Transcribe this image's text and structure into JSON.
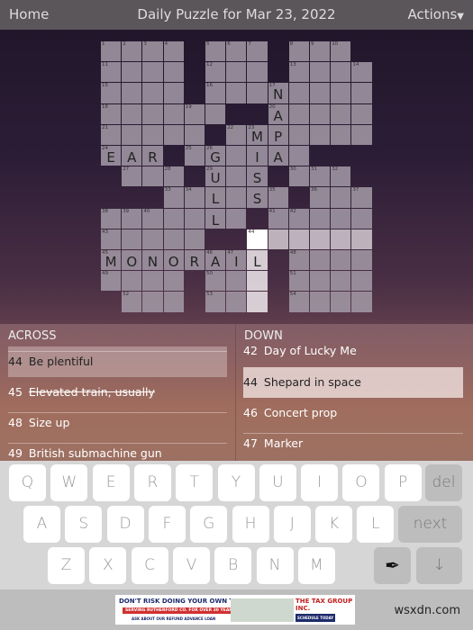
{
  "header": {
    "home": "Home",
    "title": "Daily Puzzle for Mar 23, 2022",
    "actions": "Actions",
    "actions_icon": "triangle-down-icon"
  },
  "grid": {
    "rows": [
      "....#...#...#",
      "....#...#....",
      "....#...N....",
      "......##A....",
      ".....#.MP....",
      "EAR#.G.IA.###",
      "#...#U.S#...#",
      "###..L.S.#...",
      ".....L.#.....",
      ".....##......",
      "MONORAIL#....",
      "....#...#....",
      "#...#...#...."
    ],
    "numbers": [
      [
        0,
        0,
        1
      ],
      [
        0,
        1,
        2
      ],
      [
        0,
        2,
        3
      ],
      [
        0,
        3,
        4
      ],
      [
        0,
        5,
        5
      ],
      [
        0,
        6,
        6
      ],
      [
        0,
        7,
        7
      ],
      [
        0,
        9,
        8
      ],
      [
        0,
        10,
        9
      ],
      [
        0,
        11,
        10
      ],
      [
        1,
        0,
        11
      ],
      [
        1,
        5,
        12
      ],
      [
        1,
        9,
        13
      ],
      [
        1,
        12,
        14
      ],
      [
        2,
        0,
        15
      ],
      [
        2,
        5,
        16
      ],
      [
        2,
        8,
        17
      ],
      [
        3,
        0,
        18
      ],
      [
        3,
        4,
        19
      ],
      [
        3,
        8,
        20
      ],
      [
        4,
        0,
        21
      ],
      [
        4,
        6,
        22
      ],
      [
        4,
        7,
        23
      ],
      [
        5,
        0,
        24
      ],
      [
        5,
        4,
        25
      ],
      [
        5,
        5,
        26
      ],
      [
        6,
        1,
        27
      ],
      [
        6,
        3,
        28
      ],
      [
        6,
        5,
        29
      ],
      [
        6,
        9,
        30
      ],
      [
        6,
        10,
        31
      ],
      [
        6,
        11,
        32
      ],
      [
        7,
        3,
        33
      ],
      [
        7,
        4,
        34
      ],
      [
        7,
        8,
        35
      ],
      [
        7,
        10,
        36
      ],
      [
        7,
        12,
        37
      ],
      [
        8,
        0,
        38
      ],
      [
        8,
        1,
        39
      ],
      [
        8,
        2,
        40
      ],
      [
        8,
        8,
        41
      ],
      [
        8,
        9,
        42
      ],
      [
        9,
        0,
        43
      ],
      [
        9,
        7,
        44
      ],
      [
        10,
        0,
        45
      ],
      [
        10,
        5,
        46
      ],
      [
        10,
        6,
        47
      ],
      [
        10,
        9,
        48
      ],
      [
        11,
        0,
        49
      ],
      [
        11,
        5,
        50
      ],
      [
        11,
        9,
        51
      ],
      [
        12,
        1,
        52
      ],
      [
        12,
        5,
        53
      ],
      [
        12,
        9,
        54
      ]
    ],
    "selected": [
      9,
      7
    ],
    "across_highlight": [
      [
        9,
        8
      ],
      [
        9,
        9
      ],
      [
        9,
        10
      ],
      [
        9,
        11
      ],
      [
        9,
        12
      ]
    ],
    "down_highlight": [
      [
        10,
        7
      ],
      [
        11,
        7
      ],
      [
        12,
        7
      ]
    ]
  },
  "across": {
    "title": "ACROSS",
    "items": [
      {
        "n": "44",
        "text": "Be plentiful",
        "state": "selected"
      },
      {
        "n": "45",
        "text": "Elevated train, usually",
        "state": "done"
      },
      {
        "n": "48",
        "text": "Size up",
        "state": ""
      },
      {
        "n": "49",
        "text": "British submachine gun",
        "state": ""
      }
    ]
  },
  "down": {
    "title": "DOWN",
    "items": [
      {
        "n": "42",
        "text": "Day of Lucky Me",
        "state": ""
      },
      {
        "n": "44",
        "text": "Shepard in space",
        "state": "selected"
      },
      {
        "n": "46",
        "text": "Concert prop",
        "state": ""
      },
      {
        "n": "47",
        "text": "Marker",
        "state": ""
      }
    ]
  },
  "keyboard": {
    "row1": [
      "Q",
      "W",
      "E",
      "R",
      "T",
      "Y",
      "U",
      "I",
      "O",
      "P"
    ],
    "row2": [
      "A",
      "S",
      "D",
      "F",
      "G",
      "H",
      "J",
      "K",
      "L"
    ],
    "row3": [
      "Z",
      "X",
      "C",
      "V",
      "B",
      "N",
      "M"
    ],
    "del": "del",
    "next": "next",
    "pen_icon": "pen-nib-icon",
    "down_icon": "arrow-down-icon"
  },
  "ad": {
    "headline": "DON'T RISK DOING YOUR OWN TAXES!",
    "line2": "SERVING RUTHERFORD CO. FOR OVER 30 YEARS",
    "line3": "ASK ABOUT OUR REFUND ADVANCE LOAN",
    "brand": "THE TAX GROUP INC.",
    "cta": "SCHEDULE TODAY"
  },
  "watermark": "wsxdn.com"
}
